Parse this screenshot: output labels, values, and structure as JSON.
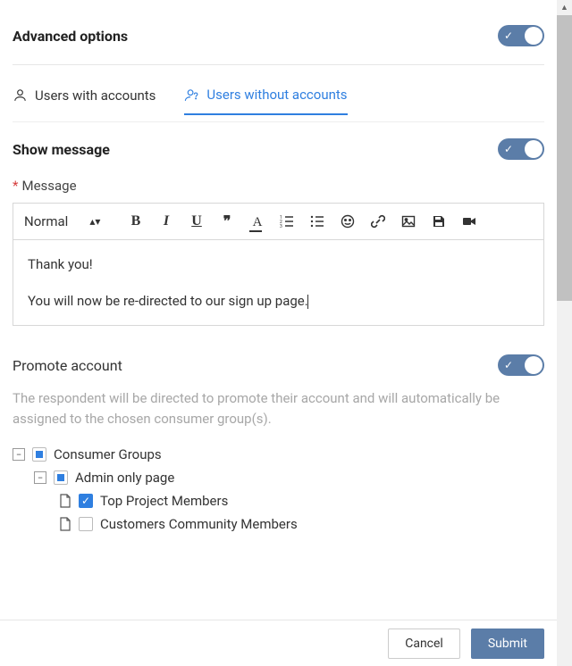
{
  "header": {
    "title": "Advanced options"
  },
  "tabs": {
    "with": "Users with accounts",
    "without": "Users without accounts"
  },
  "show_message": {
    "title": "Show message"
  },
  "message": {
    "required_mark": "*",
    "label": "Message",
    "format_option": "Normal",
    "body_line1": "Thank you!",
    "body_line2": "You will now be re-directed to our sign up page."
  },
  "promote": {
    "title": "Promote account",
    "description": "The respondent will be directed to promote their account and will automatically be assigned to the chosen consumer group(s)."
  },
  "tree": {
    "root": "Consumer Groups",
    "child1": "Admin only page",
    "leaf1": "Top Project Members",
    "leaf2": "Customers Community Members"
  },
  "footer": {
    "cancel": "Cancel",
    "submit": "Submit"
  }
}
